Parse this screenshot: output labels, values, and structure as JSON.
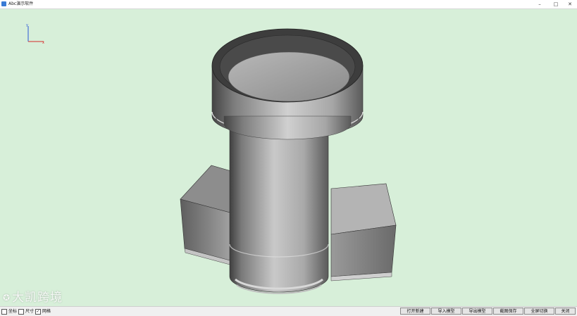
{
  "window": {
    "title": "Abc演示软件",
    "controls": {
      "minimize": "–",
      "maximize": "□",
      "close": "✕"
    }
  },
  "viewport": {
    "background": "#d7efd9",
    "axis_labels": {
      "x": "x",
      "y": "y"
    },
    "watermark": "大凯跨境"
  },
  "statusbar": {
    "checkboxes": [
      {
        "label": "坐标",
        "checked": false
      },
      {
        "label": "尺寸",
        "checked": false
      },
      {
        "label": "网格",
        "checked": true
      }
    ],
    "buttons": [
      {
        "label": "打开新建"
      },
      {
        "label": "导入模型"
      },
      {
        "label": "导出模型"
      },
      {
        "label": "截图保存"
      },
      {
        "label": "全屏切换"
      },
      {
        "label": "关闭"
      }
    ]
  }
}
